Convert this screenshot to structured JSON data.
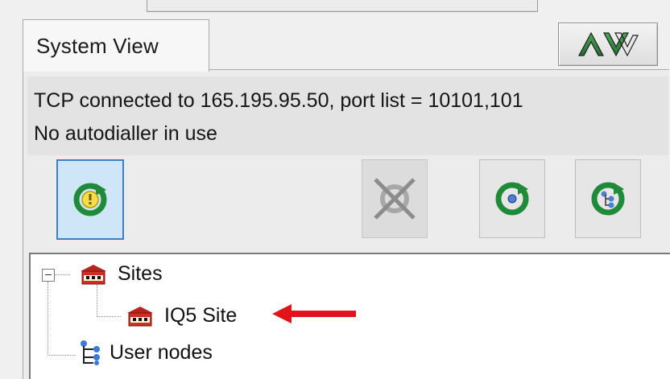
{
  "tab": {
    "label": "System View"
  },
  "logo": {
    "text": "AV"
  },
  "status": {
    "line1": "TCP connected to 165.195.95.50, port list = 10101,101",
    "line2": "No autodialler in use"
  },
  "toolbar": {
    "buttons": [
      {
        "icon": "refresh-alert-icon",
        "state": "selected"
      },
      {
        "icon": "disconnect-icon",
        "state": "disabled"
      },
      {
        "icon": "refresh-node-icon",
        "state": "normal"
      },
      {
        "icon": "refresh-tree-icon",
        "state": "normal"
      }
    ]
  },
  "tree": {
    "items": [
      {
        "label": "Sites",
        "icon": "sites-icon",
        "level": 0,
        "expanded": true
      },
      {
        "label": "IQ5 Site",
        "icon": "site-icon",
        "level": 1,
        "highlighted": true
      },
      {
        "label": "User nodes",
        "icon": "user-nodes-icon",
        "level": 0
      }
    ]
  },
  "colors": {
    "accent": "#3c7fc4",
    "arrow": "#e2141b",
    "panel": "#ececec"
  }
}
